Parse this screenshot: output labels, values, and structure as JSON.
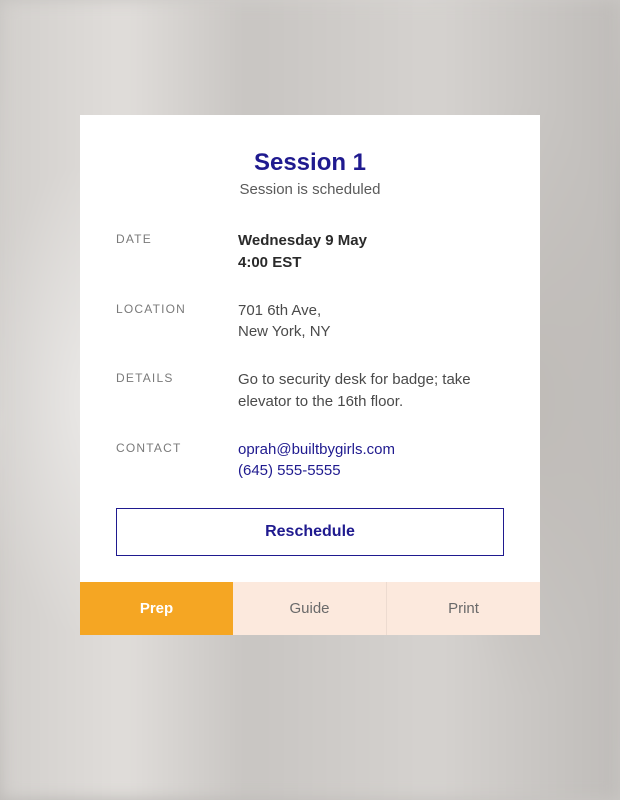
{
  "header": {
    "title": "Session 1",
    "subtitle": "Session is scheduled"
  },
  "fields": {
    "date": {
      "label": "DATE",
      "line1": "Wednesday 9 May",
      "line2": "4:00 EST"
    },
    "location": {
      "label": "LOCATION",
      "line1": "701 6th Ave,",
      "line2": "New York, NY"
    },
    "details": {
      "label": "DETAILS",
      "value": "Go to security desk for badge; take elevator to the 16th floor."
    },
    "contact": {
      "label": "CONTACT",
      "email": "oprah@builtbygirls.com",
      "phone": "(645) 555-5555"
    }
  },
  "actions": {
    "reschedule": "Reschedule"
  },
  "tabs": {
    "prep": "Prep",
    "guide": "Guide",
    "print": "Print"
  }
}
